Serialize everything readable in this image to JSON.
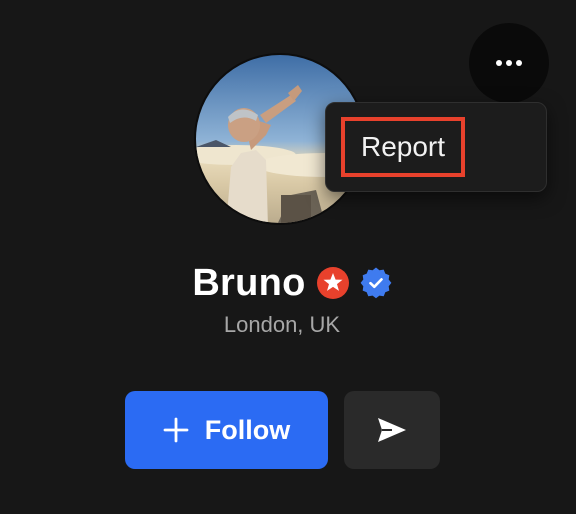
{
  "profile": {
    "name": "Bruno",
    "location": "London, UK",
    "avatar_icon": "profile-photo"
  },
  "menu": {
    "open_icon": "more-horizontal-icon",
    "items": [
      {
        "label": "Report"
      }
    ]
  },
  "actions": {
    "follow_label": "Follow",
    "follow_icon": "plus-icon",
    "send_icon": "send-icon"
  },
  "badges": {
    "star_color": "#e8412c",
    "verified_color": "#3f7bef"
  },
  "colors": {
    "background": "#171717",
    "primary": "#2b6bf3",
    "highlight": "#e8412c"
  }
}
